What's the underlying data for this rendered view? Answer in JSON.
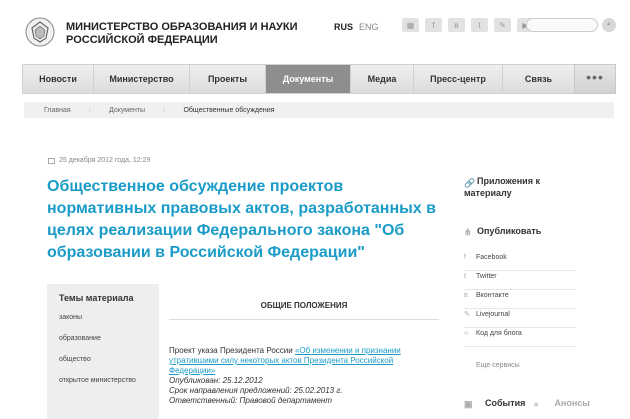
{
  "header": {
    "org_line1": "МИНИСТЕРСТВО ОБРАЗОВАНИЯ И НАУКИ",
    "org_line2": "РОССИЙСКОЙ ФЕДЕРАЦИИ",
    "lang_rus": "RUS",
    "lang_eng": "ENG",
    "socials": [
      "rss-icon",
      "facebook-icon",
      "vkontakte-icon",
      "twitter-icon",
      "livejournal-icon",
      "youtube-icon"
    ],
    "search_placeholder": ""
  },
  "nav": {
    "items": [
      {
        "label": "Новости"
      },
      {
        "label": "Министерство"
      },
      {
        "label": "Проекты"
      },
      {
        "label": "Документы"
      },
      {
        "label": "Медиа"
      },
      {
        "label": "Пресс-центр"
      },
      {
        "label": "Связь"
      }
    ],
    "active_index": 3,
    "more_label": "•••"
  },
  "breadcrumb": [
    "Главная",
    "Документы",
    "Общественные обсуждения"
  ],
  "article": {
    "date": "25 декабря 2012 года, 12:29",
    "title": "Общественное обсуждение проектов нормативных правовых актов, разработанных в целях реализации Федерального закона \"Об образовании в Российской Федерации\""
  },
  "topics": {
    "heading": "Темы материала",
    "items": [
      "законы",
      "образование",
      "общество",
      "открытое министерство"
    ]
  },
  "content": {
    "section_title": "ОБЩИЕ ПОЛОЖЕНИЯ",
    "para_prefix": "Проект указа Президента России ",
    "para_link": "«Об изменении и признании утратившими силу некоторых актов Президента Российской Федерации»",
    "published": "Опубликован: 25.12.2012",
    "deadline": "Срок направления предложений: 25.02.2013 г.",
    "department": "Ответственный: Правовой департамент"
  },
  "sidebar": {
    "attachments": "Приложения к материалу",
    "publish": "Опубликовать",
    "services": [
      {
        "label": "Facebook",
        "icon": "facebook-icon"
      },
      {
        "label": "Twitter",
        "icon": "twitter-icon"
      },
      {
        "label": "Вконтакте",
        "icon": "vkontakte-icon"
      },
      {
        "label": "Livejournal",
        "icon": "livejournal-icon"
      },
      {
        "label": "Код для блога",
        "icon": "code-icon"
      }
    ],
    "more_services": "Еще сервисы",
    "tab_events": "События",
    "tab_announcements": "Анонсы"
  },
  "colors": {
    "accent": "#1a9bc8",
    "nav_active": "#8e8e8e"
  }
}
